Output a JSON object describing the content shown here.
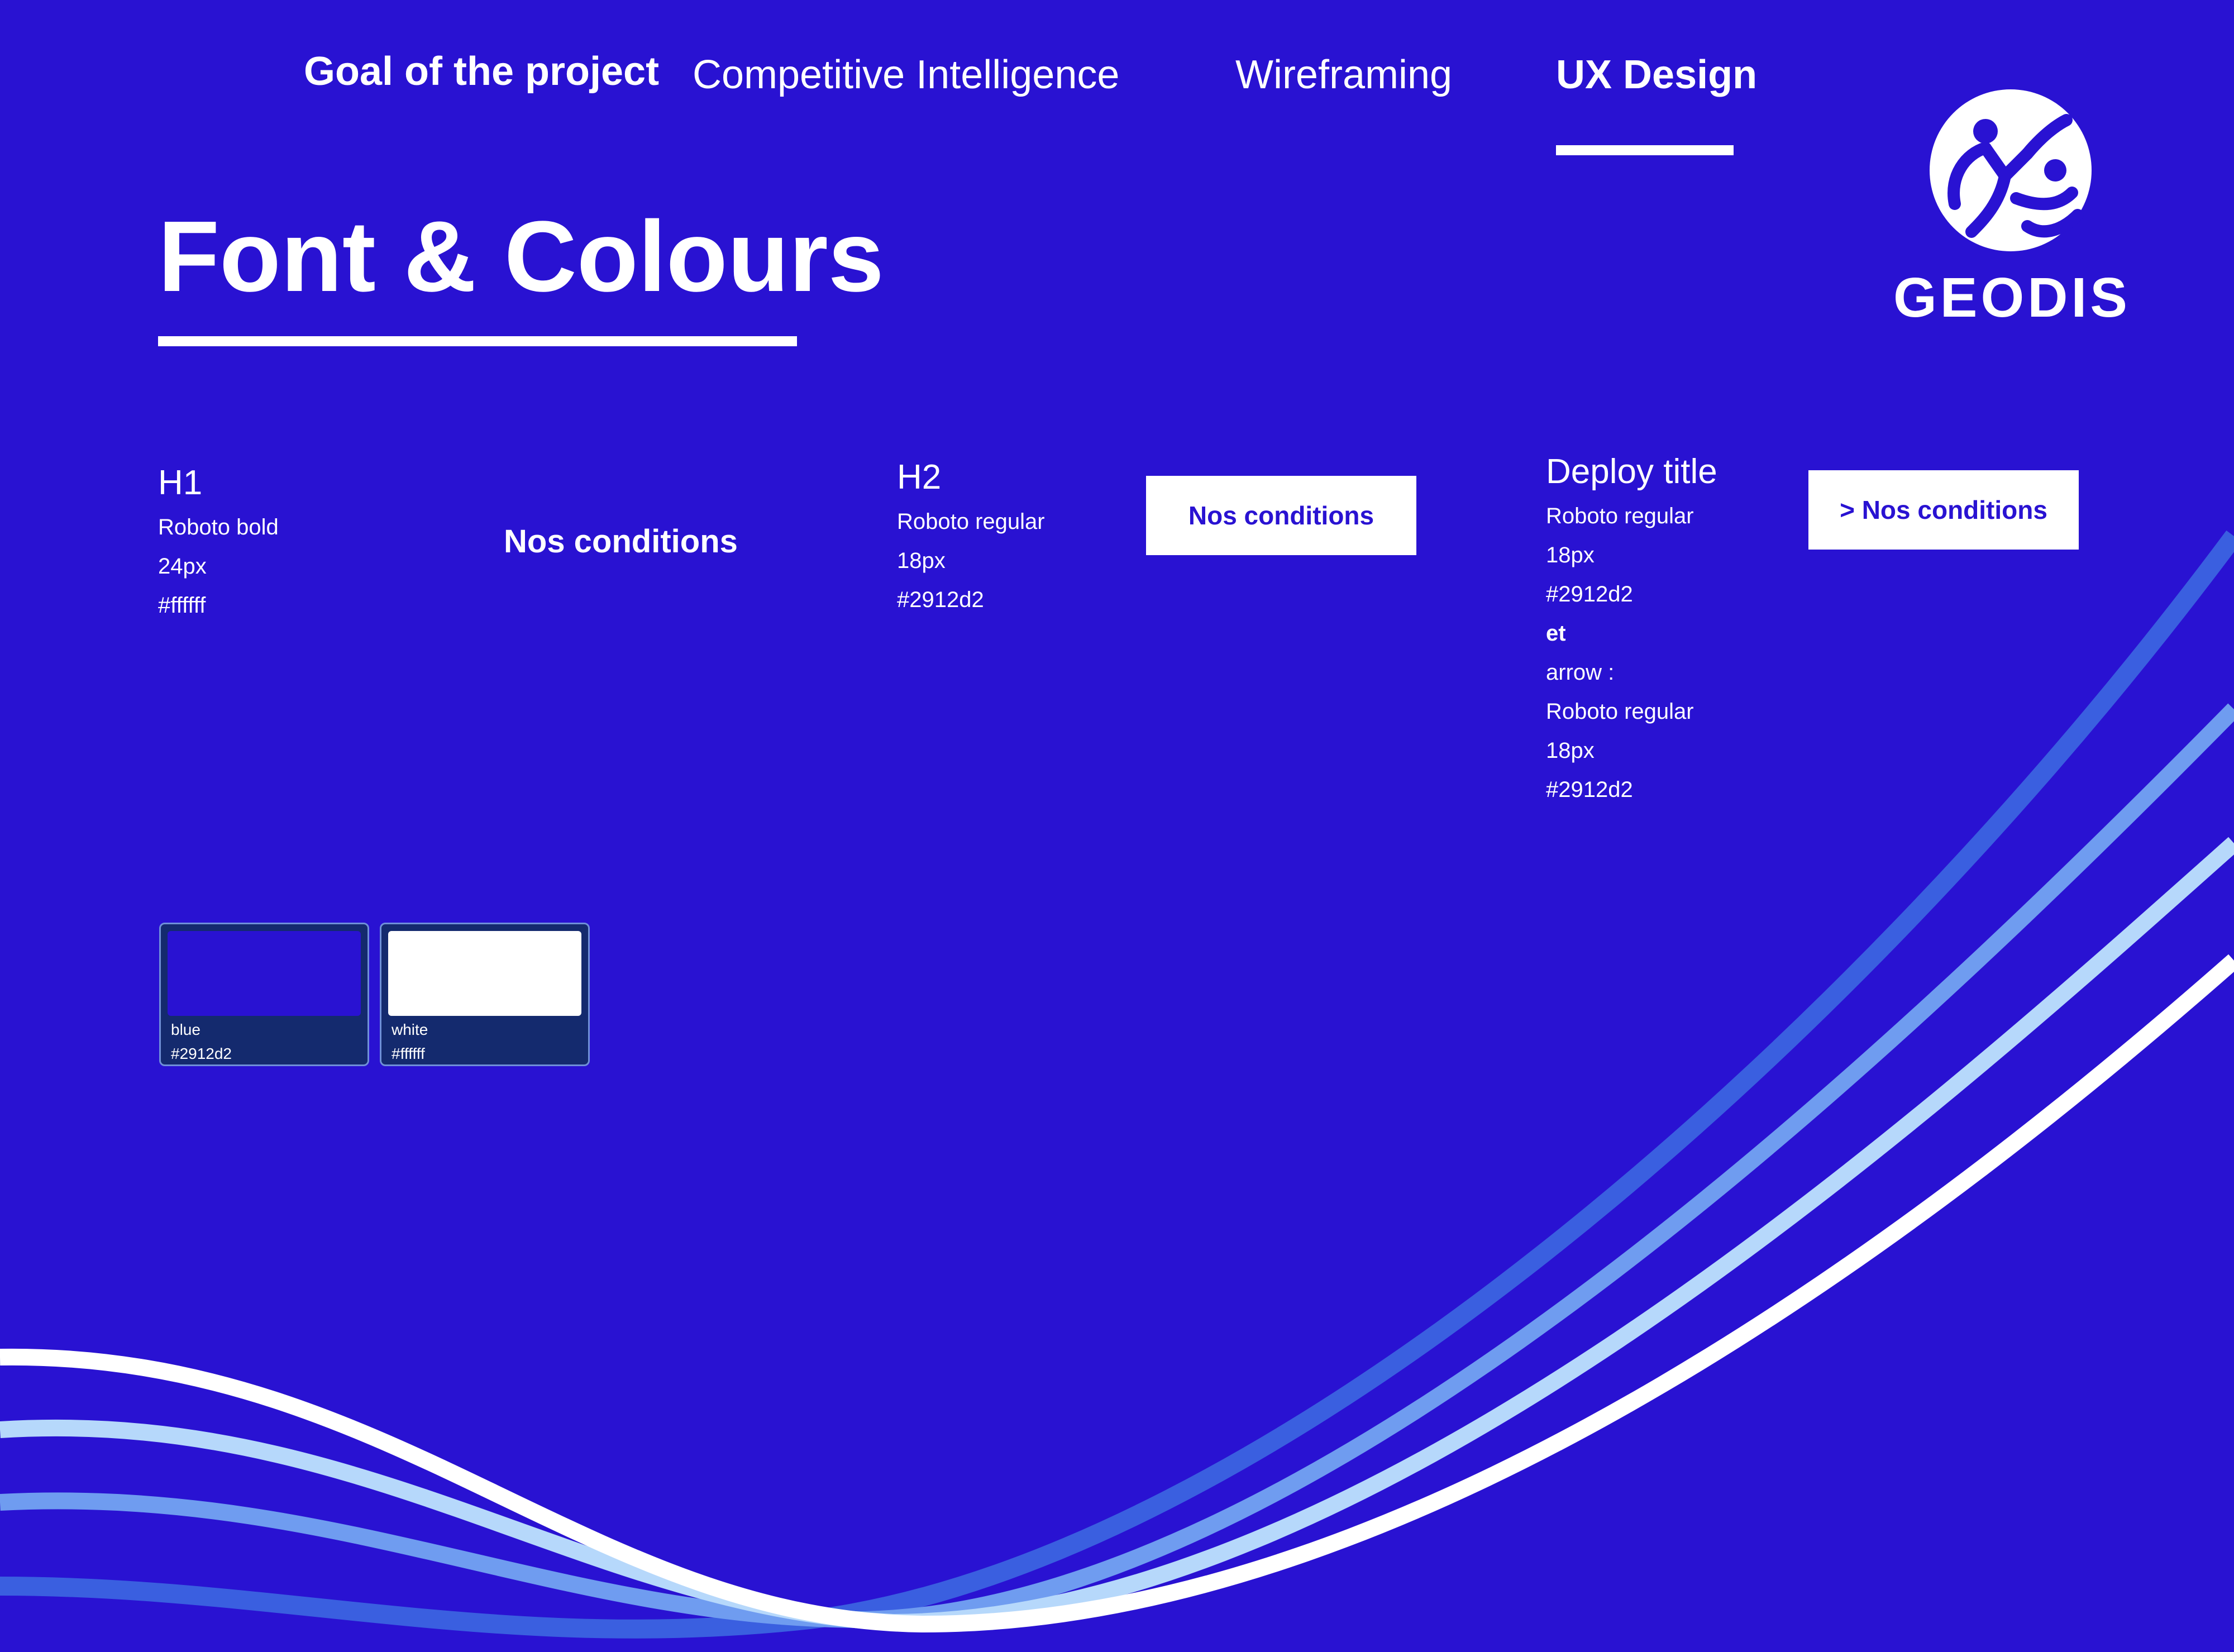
{
  "nav": {
    "items": [
      {
        "label": "Goal of the project"
      },
      {
        "label": "Competitive Intelligence"
      },
      {
        "label": "Wireframing"
      },
      {
        "label": "UX Design"
      }
    ]
  },
  "page": {
    "title": "Font & Colours"
  },
  "logo": {
    "brand": "GEODIS",
    "icon": "geodis-figure-logo"
  },
  "specs": {
    "h1": {
      "heading": "H1",
      "font": "Roboto bold",
      "size": "24px",
      "color": "#ffffff",
      "sample": "Nos conditions"
    },
    "h2": {
      "heading": "H2",
      "font": "Roboto regular",
      "size": "18px",
      "color": "#2912d2",
      "button_label": "Nos conditions"
    },
    "deploy": {
      "heading": "Deploy title",
      "font": "Roboto regular",
      "size": "18px",
      "color": "#2912d2",
      "conj": "et",
      "arrow_label": "arrow :",
      "arrow_font": "Roboto regular",
      "arrow_size": "18px",
      "arrow_color": "#2912d2",
      "button_label": "> Nos conditions"
    }
  },
  "colors": [
    {
      "name": "blue",
      "hex": "#2912d2",
      "fill": "#2912d2"
    },
    {
      "name": "white",
      "hex": "#ffffff",
      "fill": "#ffffff"
    }
  ]
}
